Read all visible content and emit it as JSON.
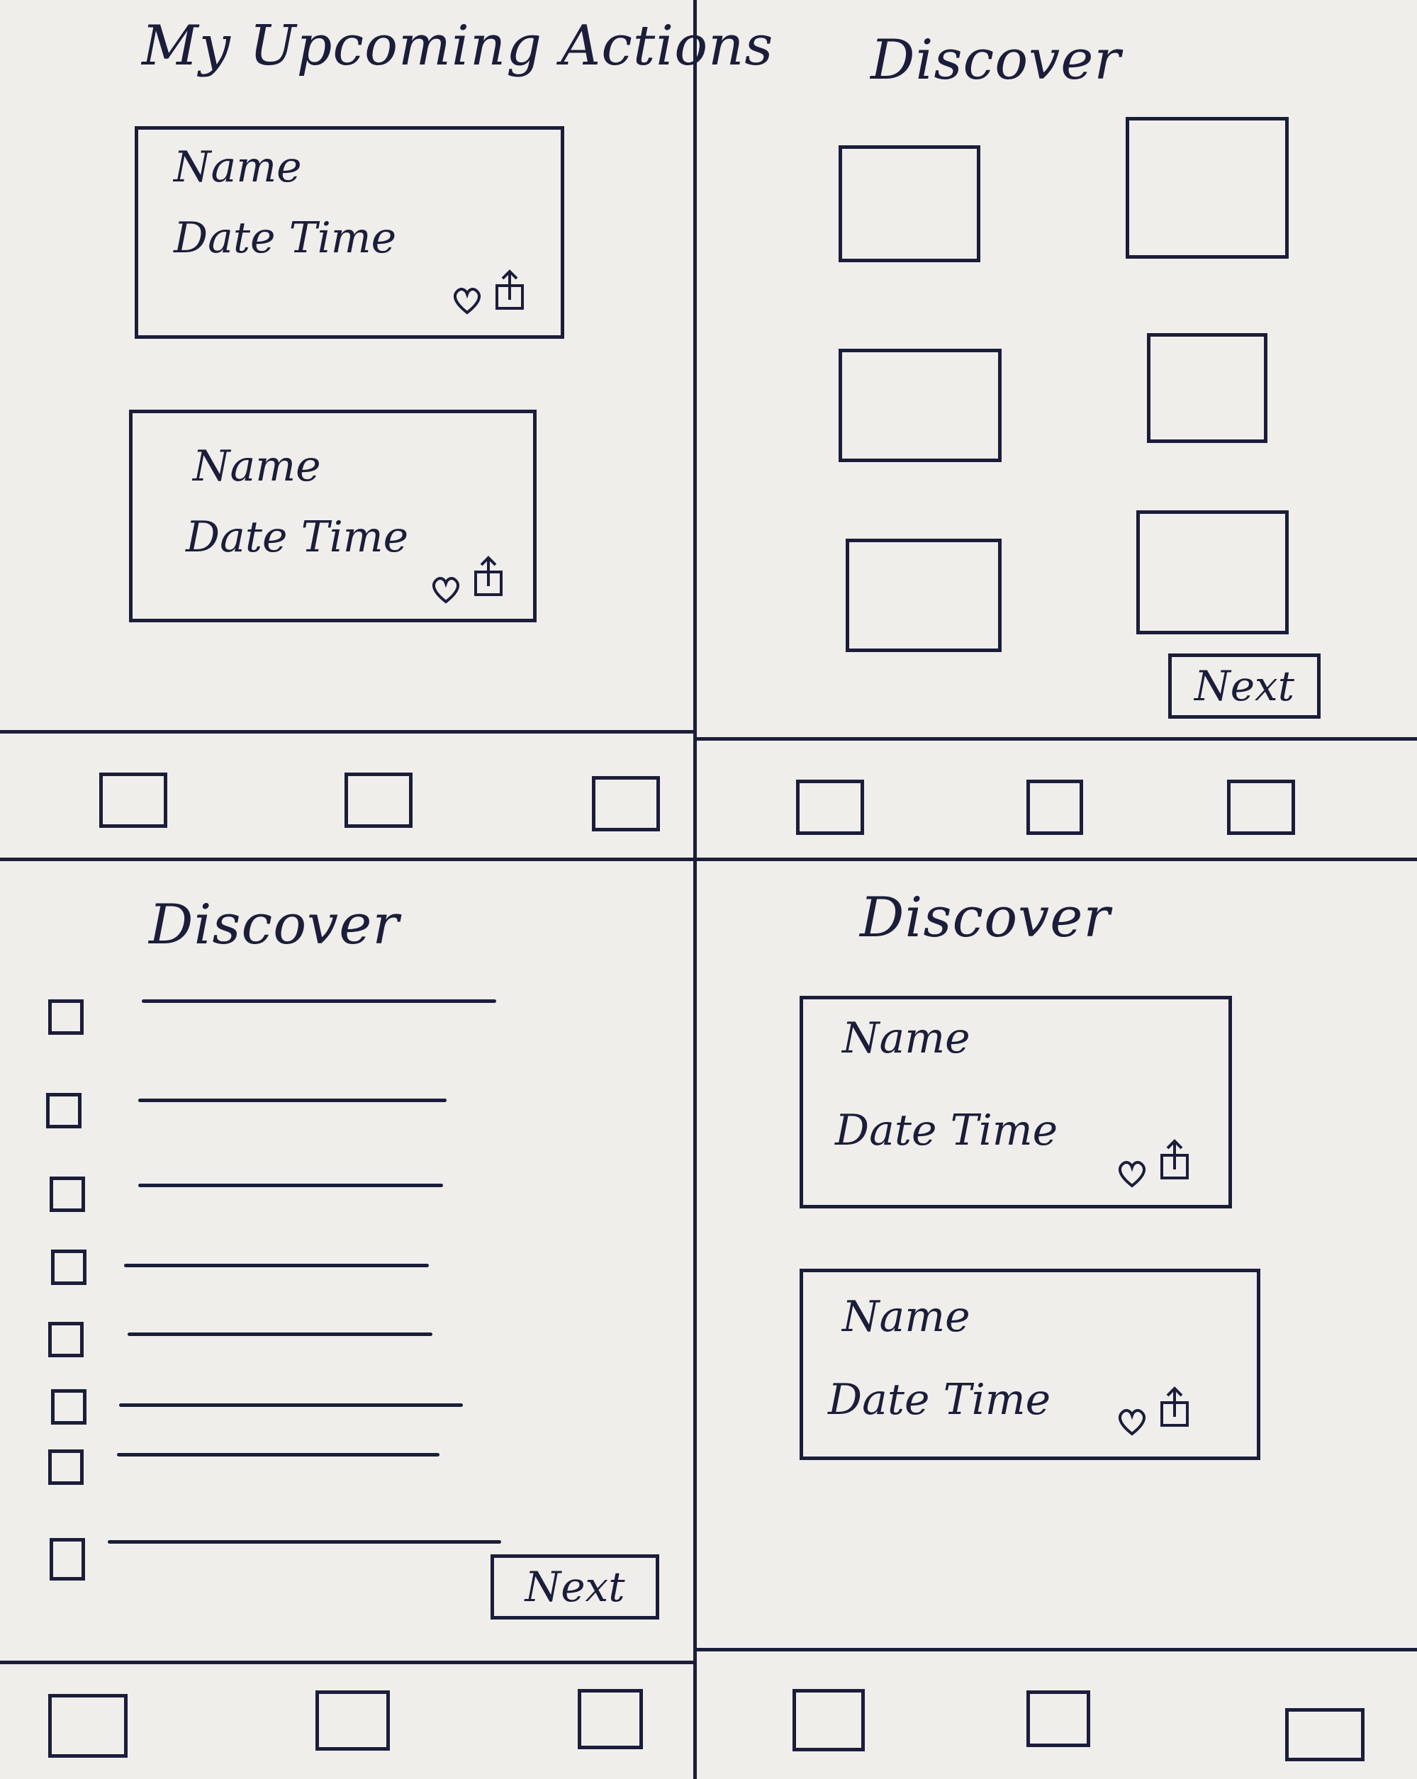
{
  "screens": {
    "upcoming": {
      "title": "My Upcoming Actions",
      "cards": [
        {
          "name": "Name",
          "datetime": "Date  Time"
        },
        {
          "name": "Name",
          "datetime": "Date Time"
        }
      ]
    },
    "discover_grid": {
      "title": "Discover",
      "next_label": "Next"
    },
    "discover_list": {
      "title": "Discover",
      "next_label": "Next"
    },
    "discover_cards": {
      "title": "Discover",
      "cards": [
        {
          "name": "Name",
          "datetime": "Date Time"
        },
        {
          "name": "Name",
          "datetime": "Date Time"
        }
      ]
    }
  },
  "icons": {
    "favorite": "heart-icon",
    "share": "share-icon"
  }
}
